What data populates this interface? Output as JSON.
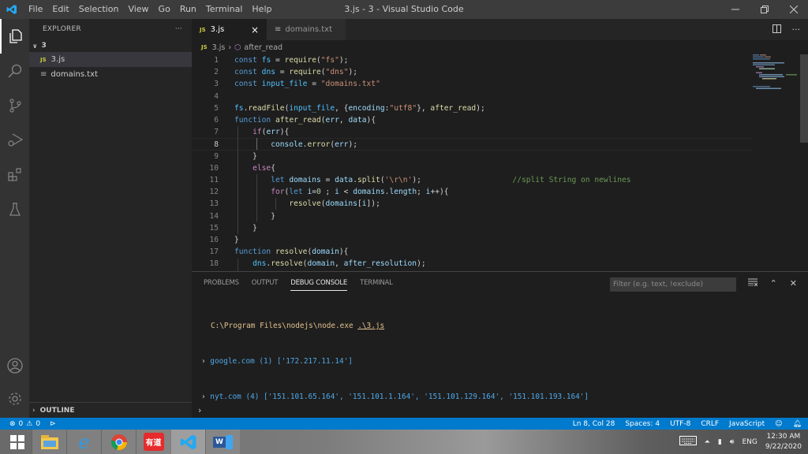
{
  "titlebar": {
    "menu": [
      "File",
      "Edit",
      "Selection",
      "View",
      "Go",
      "Run",
      "Terminal",
      "Help"
    ],
    "title": "3.js - 3 - Visual Studio Code"
  },
  "activity_bar": [
    "explorer-icon",
    "search-icon",
    "source-control-icon",
    "run-debug-icon",
    "extensions-icon",
    "testing-icon",
    "account-icon",
    "settings-gear-icon"
  ],
  "sidebar": {
    "header": "EXPLORER",
    "more": "···",
    "folder": "3",
    "files": [
      {
        "name": "3.js",
        "type": "js",
        "selected": true
      },
      {
        "name": "domains.txt",
        "type": "txt",
        "selected": false
      }
    ],
    "outline": "OUTLINE"
  },
  "tabs": [
    {
      "label": "3.js",
      "icon": "JS",
      "active": true
    },
    {
      "label": "domains.txt",
      "icon": "≡",
      "active": false
    }
  ],
  "breadcrumb": {
    "file": "3.js",
    "symbol": "after_read"
  },
  "editor": {
    "current_line": 8,
    "lines": [
      {
        "n": "1",
        "html": "<span class='kw'>const</span> <span class='cst'>fs</span> = <span class='fn'>require</span>(<span class='str'>\"fs\"</span>);"
      },
      {
        "n": "2",
        "html": "<span class='kw'>const</span> <span class='cst'>dns</span> = <span class='fn'>require</span>(<span class='str'>\"dns\"</span>);"
      },
      {
        "n": "3",
        "html": "<span class='kw'>const</span> <span class='cst'>input_file</span> = <span class='str'>\"domains.txt\"</span>"
      },
      {
        "n": "4",
        "html": ""
      },
      {
        "n": "5",
        "html": "<span class='cst'>fs</span>.<span class='fn'>readFile</span>(<span class='cst'>input_file</span>, {<span class='var'>encoding</span>:<span class='str'>\"utf8\"</span>}, <span class='fn'>after_read</span>);"
      },
      {
        "n": "6",
        "html": "<span class='kw'>function</span> <span class='fn'>after_read</span>(<span class='var'>err</span>, <span class='var'>data</span>){"
      },
      {
        "n": "7",
        "html": "    <span class='ctl'>if</span>(<span class='var'>err</span>){"
      },
      {
        "n": "8",
        "html": "        <span class='var'>console</span>.<span class='fn'>error</span>(<span class='var'>err</span>);"
      },
      {
        "n": "9",
        "html": "    }"
      },
      {
        "n": "10",
        "html": "    <span class='ctl'>else</span>{"
      },
      {
        "n": "11",
        "html": "        <span class='kw'>let</span> <span class='var'>domains</span> = <span class='var'>data</span>.<span class='fn'>split</span>(<span class='str'>'\\r\\n'</span>);                    <span class='cmt'>//split String on newlines</span>"
      },
      {
        "n": "12",
        "html": "        <span class='ctl'>for</span>(<span class='kw'>let</span> <span class='var'>i</span>=<span class='num'>0</span> ; <span class='var'>i</span> &lt; <span class='var'>domains</span>.<span class='var'>length</span>; <span class='var'>i</span>++){"
      },
      {
        "n": "13",
        "html": "            <span class='fn'>resolve</span>(<span class='var'>domains</span>[<span class='var'>i</span>]);"
      },
      {
        "n": "14",
        "html": "        }"
      },
      {
        "n": "15",
        "html": "    }"
      },
      {
        "n": "16",
        "html": "}"
      },
      {
        "n": "17",
        "html": "<span class='kw'>function</span> <span class='fn'>resolve</span>(<span class='var'>domain</span>){"
      },
      {
        "n": "18",
        "html": "    <span class='cst'>dns</span>.<span class='fn'>resolve</span>(<span class='var'>domain</span>, <span class='var'>after_resolution</span>);"
      }
    ]
  },
  "panel": {
    "tabs": [
      "PROBLEMS",
      "OUTPUT",
      "DEBUG CONSOLE",
      "TERMINAL"
    ],
    "active_tab": "DEBUG CONSOLE",
    "filter_placeholder": "Filter (e.g. text, !exclude)",
    "console": {
      "command_path": "C:\\Program Files\\nodejs\\node.exe ",
      "command_script": ".\\3.js",
      "outputs": [
        "google.com (1) ['172.217.11.14']",
        "nyt.com (4) ['151.101.65.164', '151.101.1.164', '151.101.129.164', '151.101.193.164']"
      ]
    }
  },
  "statusbar": {
    "errors": "0",
    "warnings": "0",
    "position": "Ln 8, Col 28",
    "spaces": "Spaces: 4",
    "encoding": "UTF-8",
    "eol": "CRLF",
    "language": "JavaScript"
  },
  "taskbar": {
    "apps": [
      "windows-start",
      "file-explorer",
      "internet-explorer",
      "chrome",
      "youdao-dict",
      "vscode",
      "word"
    ],
    "youdao_label": "有道",
    "word_label": "W",
    "lang": "ENG",
    "time": "12:30 AM",
    "date": "9/22/2020"
  },
  "colors": {
    "accent": "#007acc",
    "titlebar": "#3c3c3c",
    "editor_bg": "#1e1e1e"
  }
}
